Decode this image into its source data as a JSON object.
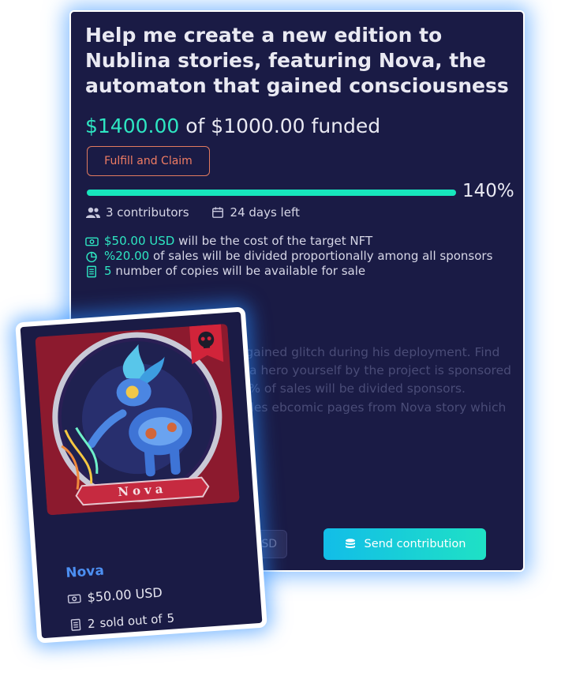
{
  "campaign": {
    "title": "Help me create a new edition to Nublina stories, featuring Nova, the automaton that gained consciousness",
    "raised": "$1400.00",
    "goal_text": "of $1000.00 funded",
    "claim_label": "Fulfill and Claim",
    "progress_percent": 140,
    "progress_label": "140%",
    "contributors": "3 contributors",
    "days_left": "24 days left",
    "nft_cost_value": "$50.00 USD",
    "nft_cost_text": "will be the cost of the target NFT",
    "sales_share_value": "%20.00",
    "sales_share_text": "of sales will be divided proportionally among all sponsors",
    "copies_value": "5",
    "copies_text": "number of copies will be available for sale",
    "description": "ton from The Society that gained glitch during his deployment. Find out how hero and become a hero yourself by the project is sponsored fully, I'll sell five va and 20% of sales will be divided sponsors. Sponsorship money and sales ebcomic pages from Nova story which will soon as it's ready"
  },
  "contribution": {
    "currency": "USD",
    "send_label": "Send contribution"
  },
  "card": {
    "name": "Nova",
    "art_label": "Nova",
    "price": "$50.00 USD",
    "sold_count": "2",
    "sold_text": "sold out of",
    "total_copies": "5"
  },
  "colors": {
    "panel_bg": "#1a1b45",
    "accent": "#2ee6c2",
    "claim": "#ef7c63",
    "card_name": "#4c8ff2"
  }
}
